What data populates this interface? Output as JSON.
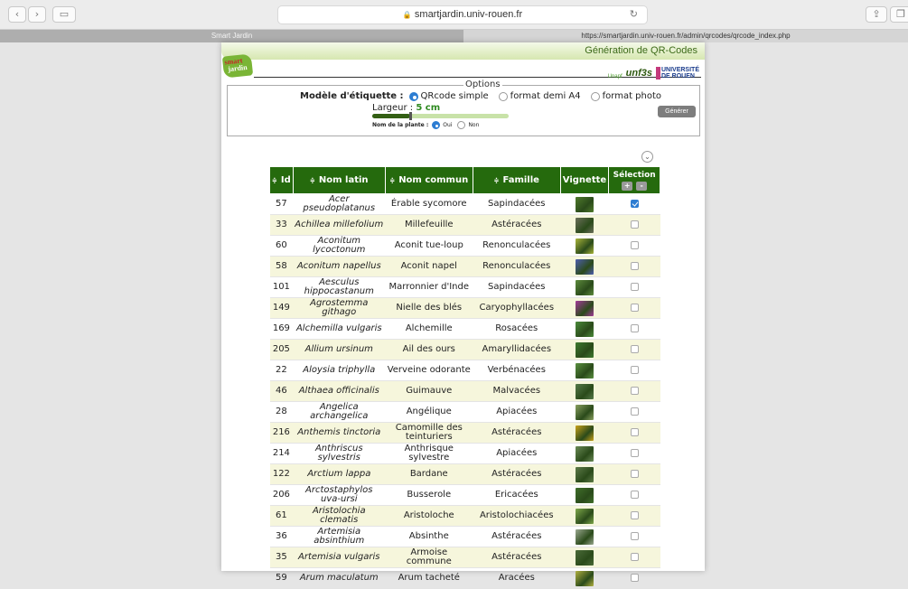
{
  "browser": {
    "url_text": "smartjardin.univ-rouen.fr",
    "tab_left": "Smart Jardin",
    "tab_right": "https://smartjardin.univ-rouen.fr/admin/qrcodes/qrcode_index.php"
  },
  "header": {
    "title": "Génération de QR-Codes",
    "logo_text_1": "smart",
    "logo_text_2": "jardin",
    "partner_1": "Unapf",
    "partner_2": "unf3s",
    "partner_3a": "UNIVERSITÉ",
    "partner_3b": "DE ROUEN"
  },
  "options": {
    "legend": "Options",
    "model_label": "Modèle d'étiquette :",
    "model_options": [
      "QRcode simple",
      "format demi A4",
      "format photo"
    ],
    "model_selected": "QRcode simple",
    "width_label": "Largeur :",
    "width_value": "5 cm",
    "slider_fraction": 0.28,
    "name_label": "Nom de la plante :",
    "name_yes": "Oui",
    "name_no": "Non",
    "name_selected": "Oui",
    "generate_label": "Générer"
  },
  "table": {
    "filter_icon": "filter-icon",
    "headers": {
      "id": "Id",
      "latin": "Nom latin",
      "common": "Nom commun",
      "family": "Famille",
      "thumb": "Vignette",
      "selection": "Sélection",
      "plus": "+",
      "minus": "-",
      "sort_icon": "≑"
    },
    "rows": [
      {
        "id": "57",
        "latin": "Acer pseudoplatanus",
        "common": "Érable sycomore",
        "family": "Sapindacées",
        "thumb": "#4f7a2c",
        "checked": true
      },
      {
        "id": "33",
        "latin": "Achillea millefolium",
        "common": "Millefeuille",
        "family": "Astéracées",
        "thumb": "#6b6f5a",
        "checked": false
      },
      {
        "id": "60",
        "latin": "Aconitum lycoctonum",
        "common": "Aconit tue-loup",
        "family": "Renonculacées",
        "thumb": "#a9b53a",
        "checked": false
      },
      {
        "id": "58",
        "latin": "Aconitum napellus",
        "common": "Aconit napel",
        "family": "Renonculacées",
        "thumb": "#4e5fb0",
        "checked": false
      },
      {
        "id": "101",
        "latin": "Aesculus hippocastanum",
        "common": "Marronnier d'Inde",
        "family": "Sapindacées",
        "thumb": "#5d8a3c",
        "checked": false
      },
      {
        "id": "149",
        "latin": "Agrostemma githago",
        "common": "Nielle des blés",
        "family": "Caryophyllacées",
        "thumb": "#a43a9a",
        "checked": false
      },
      {
        "id": "169",
        "latin": "Alchemilla vulgaris",
        "common": "Alchemille",
        "family": "Rosacées",
        "thumb": "#4a8a3a",
        "checked": false
      },
      {
        "id": "205",
        "latin": "Allium ursinum",
        "common": "Ail des ours",
        "family": "Amaryllidacées",
        "thumb": "#3d7a30",
        "checked": false
      },
      {
        "id": "22",
        "latin": "Aloysia triphylla",
        "common": "Verveine odorante",
        "family": "Verbénacées",
        "thumb": "#5a9040",
        "checked": false
      },
      {
        "id": "46",
        "latin": "Althaea officinalis",
        "common": "Guimauve",
        "family": "Malvacées",
        "thumb": "#557a4a",
        "checked": false
      },
      {
        "id": "28",
        "latin": "Angelica archangelica",
        "common": "Angélique",
        "family": "Apiacées",
        "thumb": "#8aa060",
        "checked": false
      },
      {
        "id": "216",
        "latin": "Anthemis tinctoria",
        "common": "Camomille des teinturiers",
        "family": "Astéracées",
        "thumb": "#c9a11a",
        "checked": false
      },
      {
        "id": "214",
        "latin": "Anthriscus sylvestris",
        "common": "Anthrisque sylvestre",
        "family": "Apiacées",
        "thumb": "#6a8a55",
        "checked": false
      },
      {
        "id": "122",
        "latin": "Arctium lappa",
        "common": "Bardane",
        "family": "Astéracées",
        "thumb": "#5d7a48",
        "checked": false
      },
      {
        "id": "206",
        "latin": "Arctostaphylos uva-ursi",
        "common": "Busserole",
        "family": "Ericacées",
        "thumb": "#3f6e2a",
        "checked": false
      },
      {
        "id": "61",
        "latin": "Aristolochia clematis",
        "common": "Aristoloche",
        "family": "Aristolochiacées",
        "thumb": "#7ea84a",
        "checked": false
      },
      {
        "id": "36",
        "latin": "Artemisia absinthium",
        "common": "Absinthe",
        "family": "Astéracées",
        "thumb": "#9aa890",
        "checked": false
      },
      {
        "id": "35",
        "latin": "Artemisia vulgaris",
        "common": "Armoise commune",
        "family": "Astéracées",
        "thumb": "#4a6a38",
        "checked": false
      },
      {
        "id": "59",
        "latin": "Arum maculatum",
        "common": "Arum tacheté",
        "family": "Aracées",
        "thumb": "#b0b040",
        "checked": false
      }
    ]
  }
}
